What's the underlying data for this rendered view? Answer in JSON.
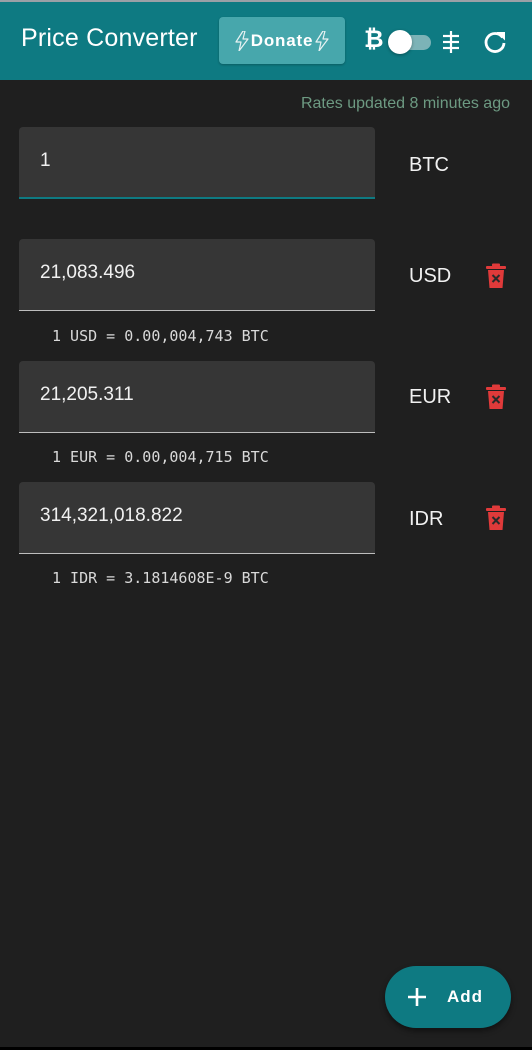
{
  "appbar": {
    "title": "Price Converter",
    "donate_label": "Donate",
    "unit_btc_symbol": "₿",
    "unit_toggle_on": false,
    "refresh_icon": "refresh-icon"
  },
  "status": {
    "rates_updated": "Rates updated 8 minutes ago"
  },
  "base": {
    "value": "1",
    "code": "BTC"
  },
  "conversions": [
    {
      "value": "21,083.496",
      "code": "USD",
      "rate": "1 USD = 0.00,004,743 BTC"
    },
    {
      "value": "21,205.311",
      "code": "EUR",
      "rate": "1 EUR = 0.00,004,715 BTC"
    },
    {
      "value": "314,321,018.822",
      "code": "IDR",
      "rate": "1 IDR = 3.1814608E-9 BTC"
    }
  ],
  "fab": {
    "label": "Add"
  },
  "colors": {
    "primary": "#0e7a82",
    "background": "#1f1f1f",
    "field": "#363636",
    "delete": "#e03a3a",
    "status_text": "#6d9a82"
  }
}
